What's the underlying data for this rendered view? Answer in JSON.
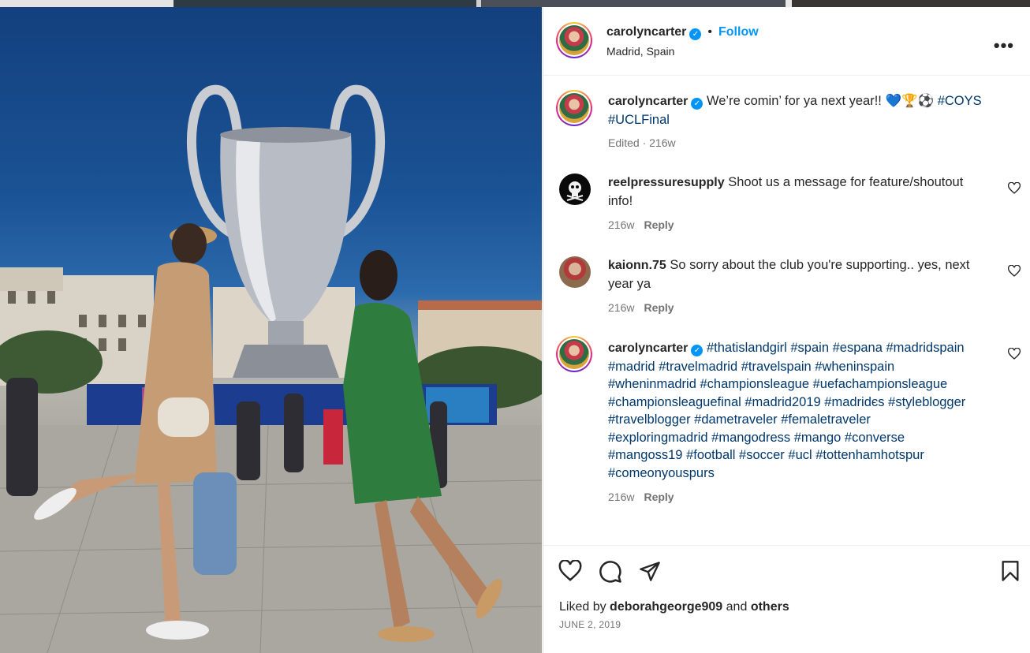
{
  "post": {
    "author": "carolyncarter",
    "follow_label": "Follow",
    "dot": "•",
    "location": "Madrid, Spain",
    "more_label": "•••"
  },
  "caption": {
    "author": "carolyncarter",
    "text": "We’re comin’ for ya next year!! 💙🏆⚽",
    "tags_line1": "#COYS",
    "tags_line2": "#UCLFinal",
    "meta": "Edited · 216w"
  },
  "comments": [
    {
      "author": "reelpressuresupply",
      "text_line1": "Shoot us a message for feature/shoutout",
      "text_line2": "info!",
      "time": "216w",
      "reply": "Reply"
    },
    {
      "author": "kaionn.75",
      "text_line1": "So sorry about the club you're supporting.. yes, next",
      "text_line2": "year ya",
      "time": "216w",
      "reply": "Reply"
    },
    {
      "author": "carolyncarter",
      "lines": [
        "#thatislandgirl #spain #espana #madridspain",
        "#madrid #travelmadrid #travelspain #wheninspain",
        "#wheninmadrid #championsleague #uefachampionsleague",
        "#championsleaguefinal #madrid2019 #madridєs #styleblogger",
        "#travelblogger #dametraveler #femaletraveler",
        "#exploringmadrid #mangodress #mango #converse",
        "#mangoss19 #football #soccer #ucl #tottenhamhotspur",
        "#comeonyouspurs"
      ],
      "time": "216w",
      "reply": "Reply"
    }
  ],
  "likes": {
    "prefix": "Liked by",
    "user": "deborahgeorge909",
    "and": "and",
    "others": "others"
  },
  "date": "JUNE 2, 2019",
  "icons": {
    "verified": "verified-badge-icon",
    "like": "heart-icon",
    "comment": "comment-bubble-icon",
    "share": "paper-plane-icon",
    "save": "bookmark-icon",
    "more": "more-options-icon"
  },
  "colors": {
    "accent": "#0095f6",
    "hashtag": "#00376b",
    "muted": "#737373"
  }
}
